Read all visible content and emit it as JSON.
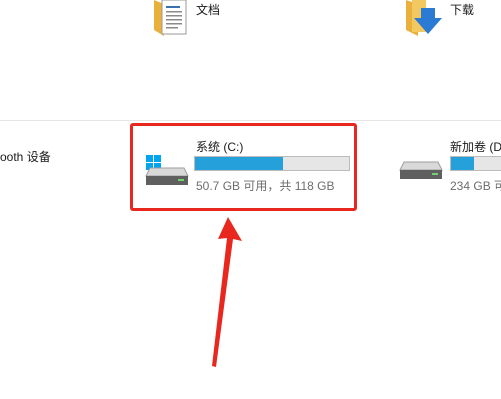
{
  "folders": [
    {
      "label": "文档",
      "icon": "documents-folder-icon"
    },
    {
      "label": "下载",
      "icon": "downloads-folder-icon"
    }
  ],
  "devices": {
    "bluetooth_label": "ooth 设备",
    "drives": [
      {
        "name": "系统 (C:)",
        "space_text": "50.7 GB 可用，共 118 GB",
        "used_fraction": 0.57,
        "icon": "system-drive-icon"
      },
      {
        "name": "新加卷 (D",
        "space_text": "234 GB 可",
        "used_fraction": 0.3,
        "icon": "drive-icon"
      }
    ]
  },
  "annotation": {
    "highlight_color": "#e8281e",
    "arrow": "red-arrow-icon"
  },
  "colors": {
    "usage_bar": "#26a0da",
    "bar_track": "#e6e6e6"
  }
}
